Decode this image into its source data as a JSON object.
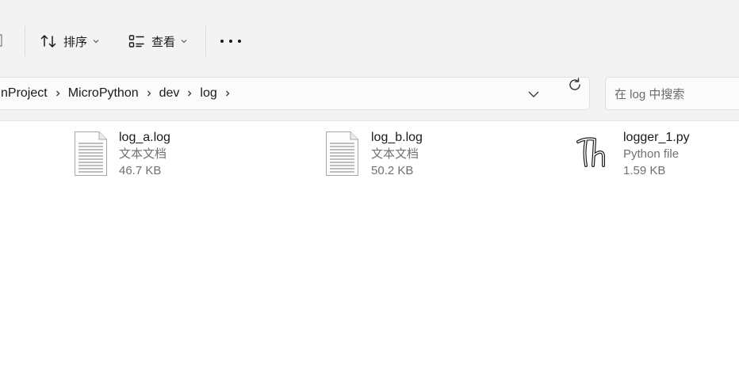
{
  "toolbar": {
    "sort_label": "排序",
    "view_label": "查看",
    "sort_icon": "sort-arrows-icon",
    "view_icon": "view-layout-icon",
    "more_icon": "more-options-icon"
  },
  "address": {
    "crumbs": [
      "nProject",
      "MicroPython",
      "dev",
      "log"
    ],
    "dropdown_icon": "chevron-down-icon",
    "refresh_icon": "refresh-icon"
  },
  "search": {
    "placeholder": "在 log 中搜索"
  },
  "files": [
    {
      "name": "log_a.log",
      "type": "文本文档",
      "size": "46.7 KB",
      "icon": "text-document-icon"
    },
    {
      "name": "log_b.log",
      "type": "文本文档",
      "size": "50.2 KB",
      "icon": "text-document-icon"
    },
    {
      "name": "logger_1.py",
      "type": "Python file",
      "size": "1.59 KB",
      "icon": "python-file-icon"
    }
  ],
  "colors": {
    "chrome_bg": "#f3f3f3",
    "content_bg": "#ffffff",
    "secondary_text": "#707070"
  }
}
